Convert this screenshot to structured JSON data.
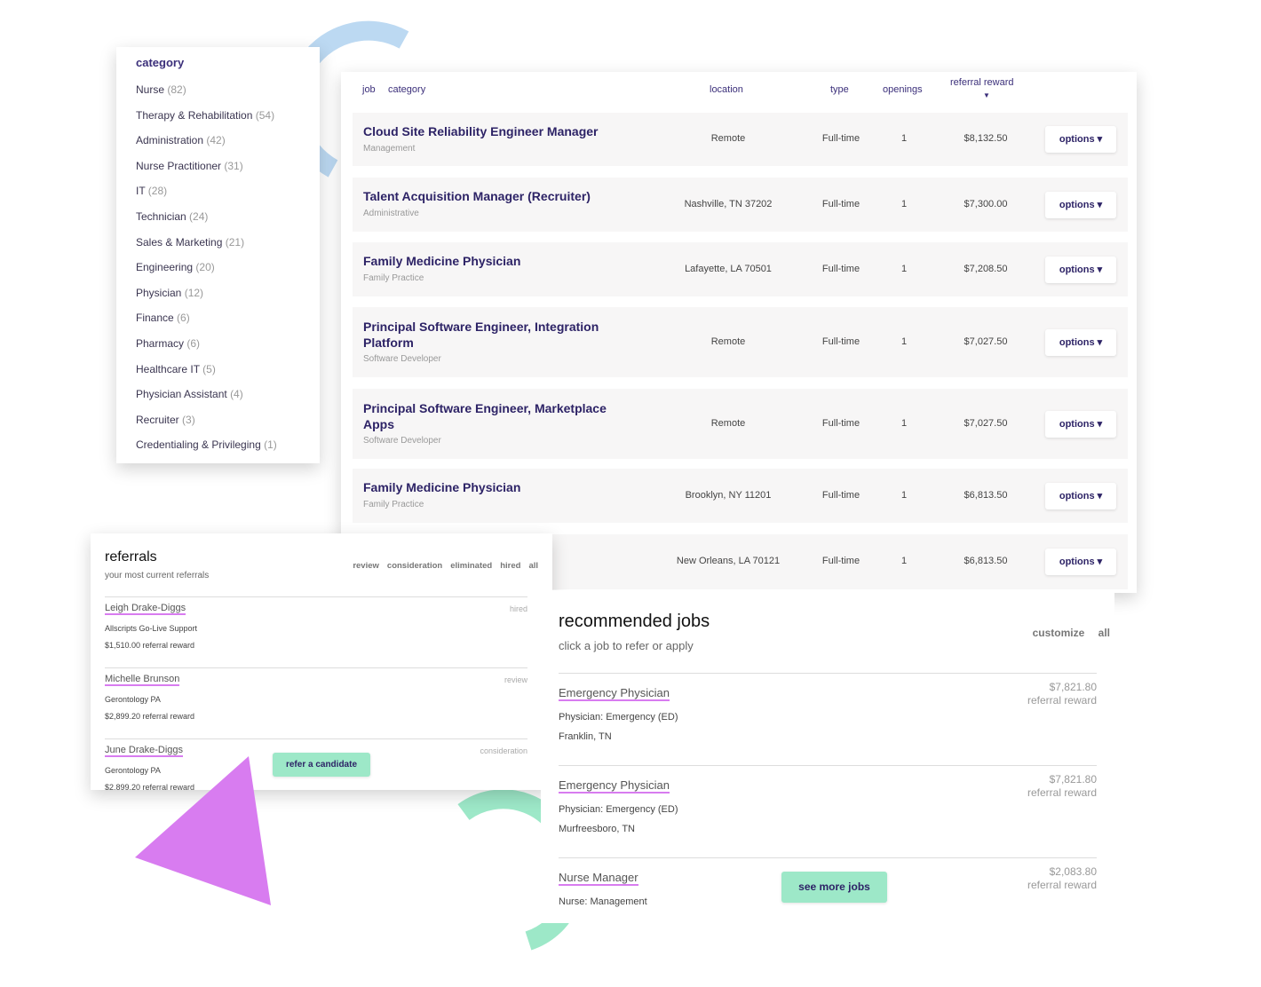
{
  "categories": {
    "title": "category",
    "items": [
      {
        "label": "Nurse",
        "count": "(82)"
      },
      {
        "label": "Therapy & Rehabilitation",
        "count": "(54)"
      },
      {
        "label": "Administration",
        "count": "(42)"
      },
      {
        "label": "Nurse Practitioner",
        "count": "(31)"
      },
      {
        "label": "IT",
        "count": "(28)"
      },
      {
        "label": "Technician",
        "count": "(24)"
      },
      {
        "label": "Sales & Marketing",
        "count": "(21)"
      },
      {
        "label": "Engineering",
        "count": "(20)"
      },
      {
        "label": "Physician",
        "count": "(12)"
      },
      {
        "label": "Finance",
        "count": "(6)"
      },
      {
        "label": "Pharmacy",
        "count": "(6)"
      },
      {
        "label": "Healthcare IT",
        "count": "(5)"
      },
      {
        "label": "Physician Assistant",
        "count": "(4)"
      },
      {
        "label": "Recruiter",
        "count": "(3)"
      },
      {
        "label": "Credentialing & Privileging",
        "count": "(1)"
      }
    ]
  },
  "jobs": {
    "headers": {
      "job": "job",
      "category": "category",
      "location": "location",
      "type": "type",
      "openings": "openings",
      "reward": "referral reward"
    },
    "rows": [
      {
        "title": "Cloud Site Reliability Engineer Manager",
        "category": "Management",
        "location": "Remote",
        "type": "Full-time",
        "openings": "1",
        "reward": "$8,132.50",
        "options": "options ▾"
      },
      {
        "title": "Talent Acquisition Manager (Recruiter)",
        "category": "Administrative",
        "location": "Nashville, TN 37202",
        "type": "Full-time",
        "openings": "1",
        "reward": "$7,300.00",
        "options": "options ▾"
      },
      {
        "title": "Family Medicine Physician",
        "category": "Family Practice",
        "location": "Lafayette, LA 70501",
        "type": "Full-time",
        "openings": "1",
        "reward": "$7,208.50",
        "options": "options ▾"
      },
      {
        "title": "Principal Software Engineer, Integration Platform",
        "category": "Software Developer",
        "location": "Remote",
        "type": "Full-time",
        "openings": "1",
        "reward": "$7,027.50",
        "options": "options ▾"
      },
      {
        "title": "Principal Software Engineer, Marketplace Apps",
        "category": "Software Developer",
        "location": "Remote",
        "type": "Full-time",
        "openings": "1",
        "reward": "$7,027.50",
        "options": "options ▾"
      },
      {
        "title": "Family Medicine Physician",
        "category": "Family Practice",
        "location": "Brooklyn, NY 11201",
        "type": "Full-time",
        "openings": "1",
        "reward": "$6,813.50",
        "options": "options ▾"
      },
      {
        "title": "",
        "category": "",
        "location": "New Orleans, LA 70121",
        "type": "Full-time",
        "openings": "1",
        "reward": "$6,813.50",
        "options": "options ▾"
      }
    ]
  },
  "referrals": {
    "title": "referrals",
    "subtitle": "your most current referrals",
    "tabs": [
      "review",
      "consideration",
      "eliminated",
      "hired",
      "all"
    ],
    "items": [
      {
        "name": "Leigh Drake-Diggs",
        "status": "hired",
        "job": "Allscripts Go-Live Support",
        "reward": "$1,510.00 referral reward"
      },
      {
        "name": "Michelle Brunson",
        "status": "review",
        "job": "Gerontology PA",
        "reward": "$2,899.20 referral reward"
      },
      {
        "name": "June Drake-Diggs",
        "status": "consideration",
        "job": "Gerontology PA",
        "reward": "$2,899.20 referral reward"
      }
    ],
    "button": "refer a candidate"
  },
  "recommended": {
    "title": "recommended jobs",
    "subtitle": "click a job to refer or apply",
    "links": [
      "customize",
      "all"
    ],
    "items": [
      {
        "title": "Emergency Physician",
        "category": "Physician: Emergency (ED)",
        "location": "Franklin, TN",
        "reward": "$7,821.80",
        "reward_label": "referral reward"
      },
      {
        "title": "Emergency Physician",
        "category": "Physician: Emergency (ED)",
        "location": "Murfreesboro, TN",
        "reward": "$7,821.80",
        "reward_label": "referral reward"
      },
      {
        "title": "Nurse Manager",
        "category": "Nurse: Management",
        "location": "",
        "reward": "$2,083.80",
        "reward_label": "referral reward"
      }
    ],
    "button": "see more jobs"
  },
  "colors": {
    "title": "#2d2366",
    "underline": "#d87cf0",
    "button": "#9de8c8",
    "arc_blue": "#bcd9f2",
    "triangle": "#d87cf0",
    "arc_green": "#9de8c8"
  }
}
